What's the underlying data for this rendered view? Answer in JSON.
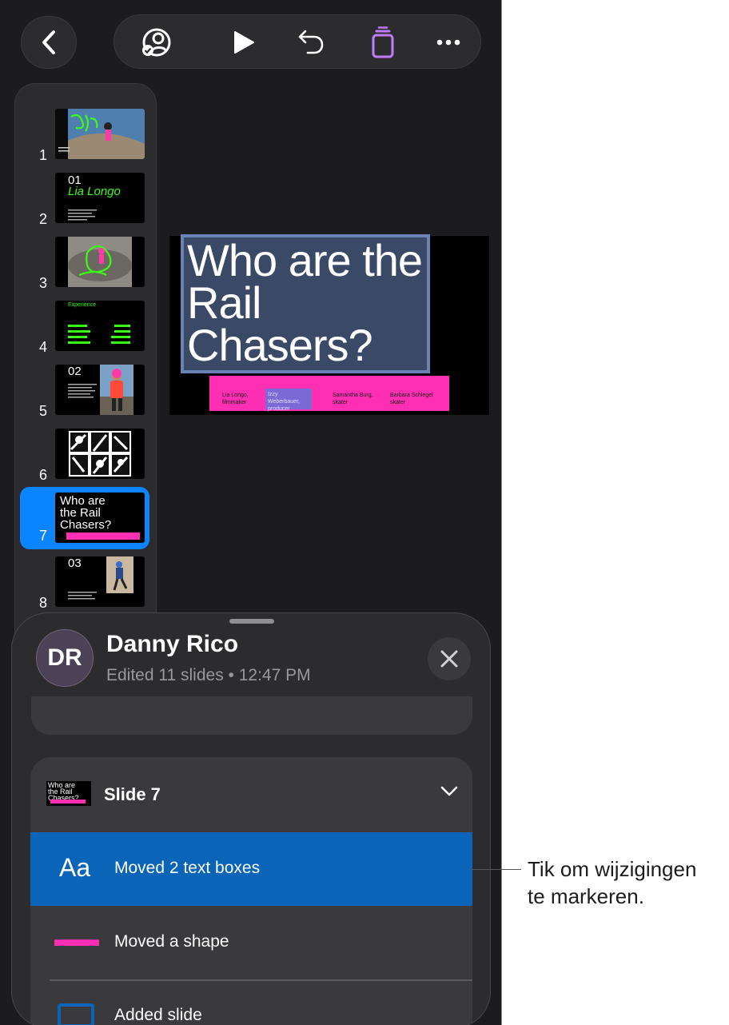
{
  "toolbar": {
    "back_icon": "chevron-left-icon",
    "collab_icon": "collaboration-icon",
    "play_icon": "play-icon",
    "undo_icon": "undo-icon",
    "format_icon": "format-icon",
    "more_icon": "more-icon",
    "accent_color": "#bf7bff"
  },
  "navigator": {
    "items": [
      {
        "number": "1"
      },
      {
        "number": "2",
        "thumb_title": "Lia Longo",
        "thumb_num": "01"
      },
      {
        "number": "3"
      },
      {
        "number": "4",
        "thumb_title": "Experience"
      },
      {
        "number": "5",
        "thumb_num": "02"
      },
      {
        "number": "6"
      },
      {
        "number": "7",
        "thumb_title": "Who are the Rail Chasers?"
      },
      {
        "number": "8",
        "thumb_num": "03"
      }
    ],
    "selected_color": "#0a84ff"
  },
  "canvas": {
    "title": "Who are the Rail Chasers?",
    "credits": [
      "Lia Longo, filmmaker",
      "Izzy Weberbauer, producer",
      "Samantha Burg, skater",
      "Barbara Schlegel skater"
    ],
    "accent_color": "#ff2fb3"
  },
  "sheet": {
    "avatar_initials": "DR",
    "user_name": "Danny Rico",
    "user_meta": "Edited 11 slides • 12:47 PM",
    "close_icon": "close-icon",
    "card": {
      "thumb_text": "Who are the Rail Chasers?",
      "title": "Slide 7",
      "chevron_icon": "chevron-down-icon",
      "changes": [
        {
          "icon": "text-icon",
          "glyph": "Aa",
          "label": "Moved 2 text boxes"
        },
        {
          "icon": "shape-icon",
          "label": "Moved a shape"
        },
        {
          "icon": "slide-icon",
          "label": "Added slide"
        }
      ]
    }
  },
  "callout": {
    "line1": "Tik om wijzigingen",
    "line2": "te markeren."
  }
}
